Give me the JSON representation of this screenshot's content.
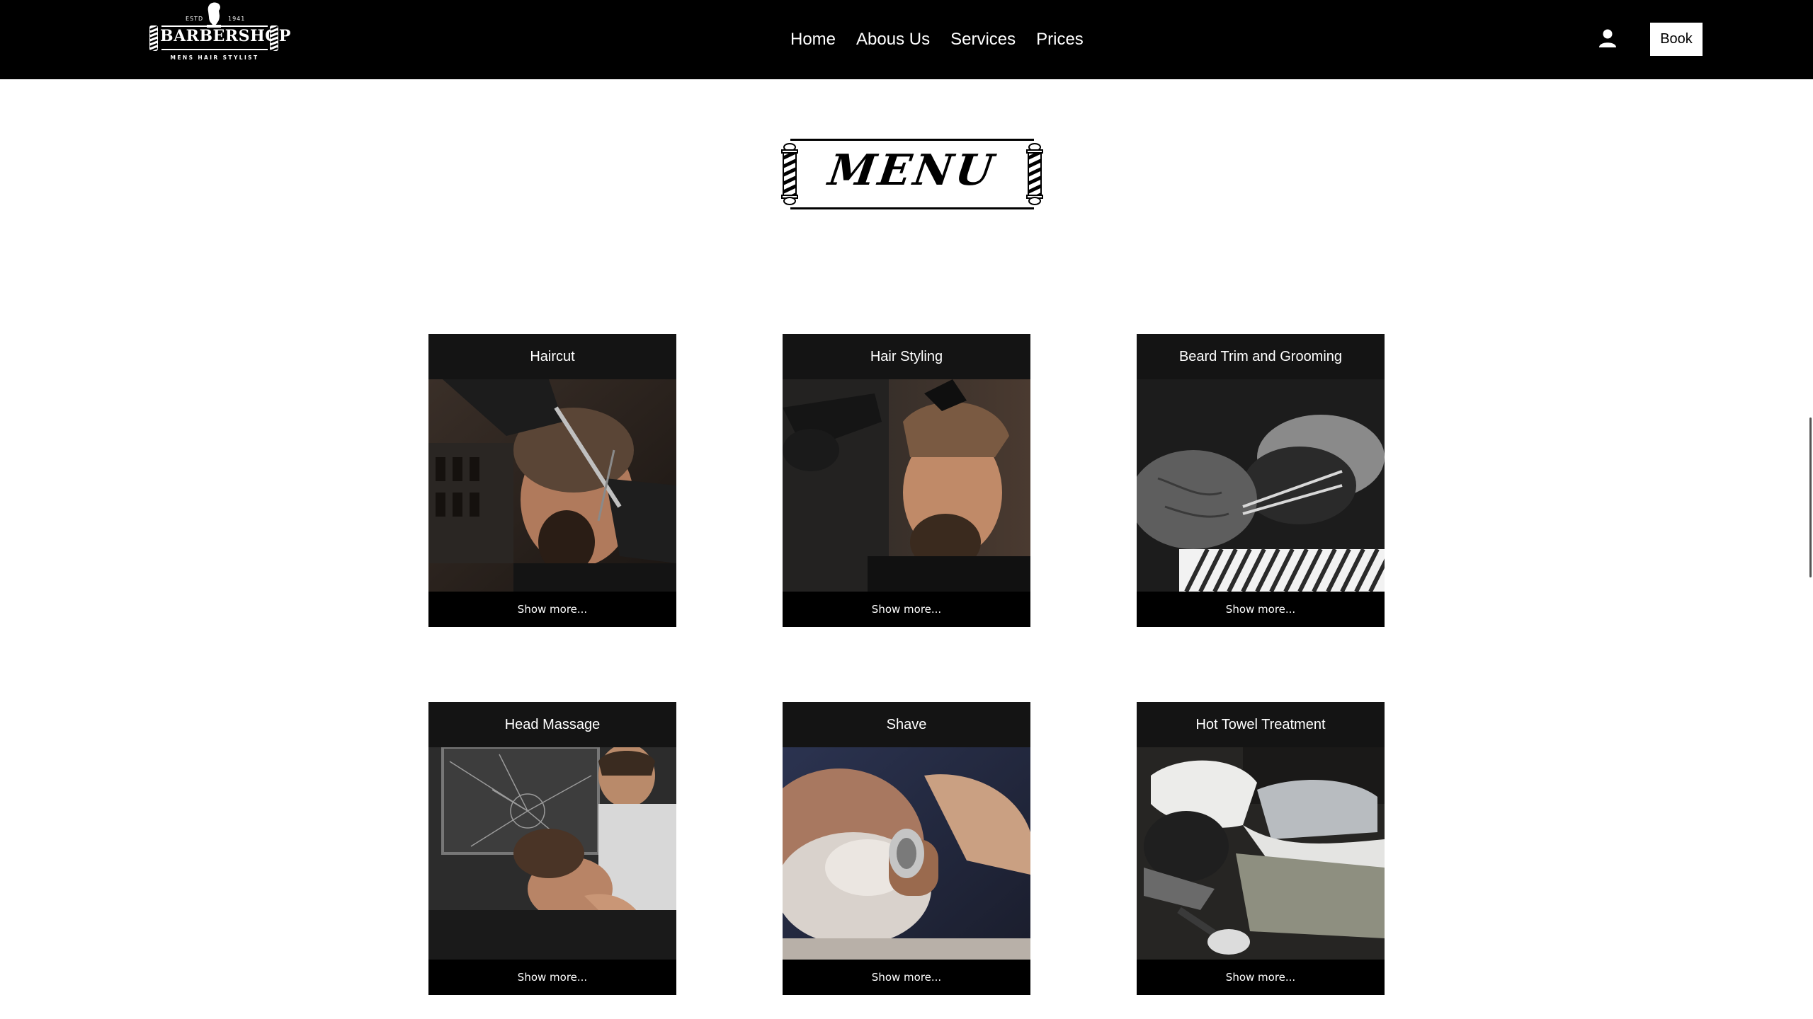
{
  "header": {
    "logo": {
      "estd": "ESTD",
      "year": "1941",
      "brand": "BARBERSHOP",
      "tagline": "MENS HAIR STYLIST"
    },
    "nav": [
      {
        "label": "Home"
      },
      {
        "label": "Abous Us"
      },
      {
        "label": "Services"
      },
      {
        "label": "Prices"
      }
    ],
    "user_icon": "user-icon",
    "book_label": "Book"
  },
  "menu_banner": {
    "title": "MENU"
  },
  "services": [
    {
      "title": "Haircut",
      "more": "Show more...",
      "photo": "haircut-photo"
    },
    {
      "title": "Hair Styling",
      "more": "Show more...",
      "photo": "hair-styling-photo"
    },
    {
      "title": "Beard Trim and Grooming",
      "more": "Show more...",
      "photo": "beard-trim-photo"
    },
    {
      "title": "Head Massage",
      "more": "Show more...",
      "photo": "head-massage-photo"
    },
    {
      "title": "Shave",
      "more": "Show more...",
      "photo": "shave-photo"
    },
    {
      "title": "Hot Towel Treatment",
      "more": "Show more...",
      "photo": "hot-towel-photo"
    }
  ],
  "colors": {
    "navbar": "#000000",
    "card_header": "#141414",
    "accent": "#ffffff"
  }
}
